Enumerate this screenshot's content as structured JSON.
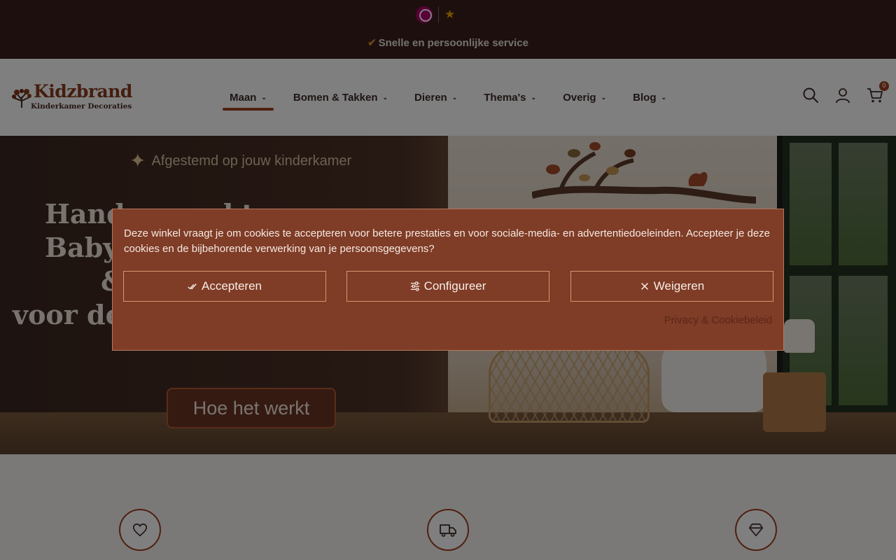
{
  "topbar": {
    "usp_check": "✔",
    "usp_text": "Snelle en persoonlijke service",
    "trust_icons": [
      "kiyoh-logo-icon",
      "star-icon"
    ]
  },
  "header": {
    "logo_name": "Kidzbrand",
    "logo_subtitle": "Kinderkamer Decoraties",
    "nav": [
      {
        "label": "Maan",
        "active": true
      },
      {
        "label": "Bomen & Takken"
      },
      {
        "label": "Dieren"
      },
      {
        "label": "Thema's"
      },
      {
        "label": "Overig"
      },
      {
        "label": "Blog"
      }
    ],
    "cart_count": "0",
    "icons": [
      "search-icon",
      "user-icon",
      "cart-icon"
    ]
  },
  "hero": {
    "tagline": "Afgestemd op jouw kinderkamer",
    "title_line1": "Handgemaakte Babymuurtjes",
    "title_line2": "& Muurdecoraties",
    "title_line3": "voor de kinderkamer",
    "button_label": "Hoe het werkt"
  },
  "features": {
    "icons": [
      "heart-icon",
      "truck-icon",
      "diamond-icon"
    ]
  },
  "cookie": {
    "text": "Deze winkel vraagt je om cookies te accepteren voor betere prestaties en voor sociale-media- en advertentiedoeleinden. Accepteer je deze cookies en de bijbehorende verwerking van je persoonsgegevens?",
    "accept_label": "Accepteren",
    "configure_label": "Configureer",
    "reject_label": "Weigeren",
    "policy_link": "Privacy & Cookiebeleid"
  },
  "colors": {
    "brand": "#a0411f",
    "dialog_bg": "#7f3c26",
    "topbar_bg": "#3a1f1b"
  }
}
